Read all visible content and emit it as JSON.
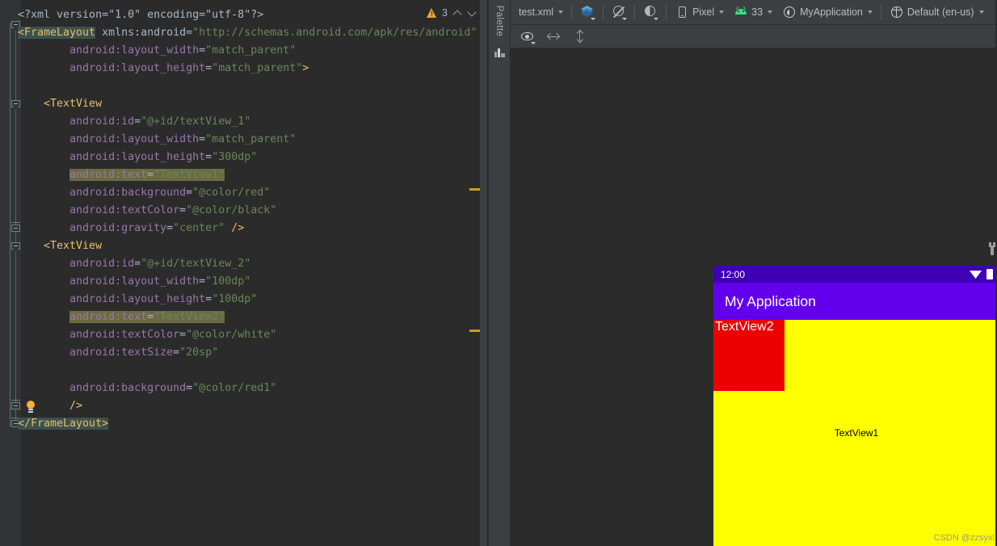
{
  "editor": {
    "code_lines": [
      [
        {
          "t": "<?xml version=\"1.0\" encoding=\"utf-8\"?>",
          "c": "decl"
        }
      ],
      [
        {
          "t": "<FrameLayout",
          "c": "tag hl-tag"
        },
        {
          "t": " xmlns:android",
          "c": "ns"
        },
        {
          "t": "=",
          "c": "eq"
        },
        {
          "t": "\"http://schemas.android.com/apk/res/android\"",
          "c": "val"
        }
      ],
      [
        {
          "t": "        android:layout_width",
          "c": "attr"
        },
        {
          "t": "=",
          "c": "eq"
        },
        {
          "t": "\"match_parent\"",
          "c": "val"
        }
      ],
      [
        {
          "t": "        android:layout_height",
          "c": "attr"
        },
        {
          "t": "=",
          "c": "eq"
        },
        {
          "t": "\"match_parent\"",
          "c": "val"
        },
        {
          "t": ">",
          "c": "tag"
        }
      ],
      [],
      [
        {
          "t": "    <TextView",
          "c": "tag"
        }
      ],
      [
        {
          "t": "        android:id",
          "c": "attr"
        },
        {
          "t": "=",
          "c": "eq"
        },
        {
          "t": "\"@+id/textView_1\"",
          "c": "val"
        }
      ],
      [
        {
          "t": "        android:layout_width",
          "c": "attr"
        },
        {
          "t": "=",
          "c": "eq"
        },
        {
          "t": "\"match_parent\"",
          "c": "val"
        }
      ],
      [
        {
          "t": "        android:layout_height",
          "c": "attr"
        },
        {
          "t": "=",
          "c": "eq"
        },
        {
          "t": "\"300dp\"",
          "c": "val"
        }
      ],
      [
        {
          "t": "        ",
          "c": "attr"
        },
        {
          "t": "android:text",
          "c": "attr hl-attr"
        },
        {
          "t": "=",
          "c": "eq hl-attr"
        },
        {
          "t": "\"TextView1\"",
          "c": "val hl-attr"
        }
      ],
      [
        {
          "t": "        android:background",
          "c": "attr"
        },
        {
          "t": "=",
          "c": "eq"
        },
        {
          "t": "\"@color/red\"",
          "c": "val"
        }
      ],
      [
        {
          "t": "        android:textColor",
          "c": "attr"
        },
        {
          "t": "=",
          "c": "eq"
        },
        {
          "t": "\"@color/black\"",
          "c": "val"
        }
      ],
      [
        {
          "t": "        android:gravity",
          "c": "attr"
        },
        {
          "t": "=",
          "c": "eq"
        },
        {
          "t": "\"center\" ",
          "c": "val"
        },
        {
          "t": "/>",
          "c": "tag"
        }
      ],
      [
        {
          "t": "    <TextView",
          "c": "tag"
        }
      ],
      [
        {
          "t": "        android:id",
          "c": "attr"
        },
        {
          "t": "=",
          "c": "eq"
        },
        {
          "t": "\"@+id/textView_2\"",
          "c": "val"
        }
      ],
      [
        {
          "t": "        android:layout_width",
          "c": "attr"
        },
        {
          "t": "=",
          "c": "eq"
        },
        {
          "t": "\"100dp\"",
          "c": "val"
        }
      ],
      [
        {
          "t": "        android:layout_height",
          "c": "attr"
        },
        {
          "t": "=",
          "c": "eq"
        },
        {
          "t": "\"100dp\"",
          "c": "val"
        }
      ],
      [
        {
          "t": "        ",
          "c": "attr"
        },
        {
          "t": "android:text",
          "c": "attr hl-attr"
        },
        {
          "t": "=",
          "c": "eq hl-attr"
        },
        {
          "t": "\"TextView2\"",
          "c": "val hl-attr"
        }
      ],
      [
        {
          "t": "        android:textColor",
          "c": "attr"
        },
        {
          "t": "=",
          "c": "eq"
        },
        {
          "t": "\"@color/white\"",
          "c": "val"
        }
      ],
      [
        {
          "t": "        android:textSize",
          "c": "attr"
        },
        {
          "t": "=",
          "c": "eq"
        },
        {
          "t": "\"20sp\"",
          "c": "val"
        }
      ],
      [],
      [
        {
          "t": "        android:background",
          "c": "attr"
        },
        {
          "t": "=",
          "c": "eq"
        },
        {
          "t": "\"@color/red1\"",
          "c": "val"
        }
      ],
      [
        {
          "t": "        ",
          "c": "attr"
        },
        {
          "t": "/>",
          "c": "tag"
        }
      ],
      [
        {
          "t": "</FrameLayout>",
          "c": "tag hl-tag"
        }
      ]
    ],
    "inspection": {
      "warning_count": "3",
      "warning_icon": "warning-triangle-icon",
      "prev_icon": "chevron-up-icon",
      "next_icon": "chevron-down-icon"
    },
    "intention_bulb_icon": "lightbulb-icon"
  },
  "palette": {
    "label": "Palette",
    "icon": "palette-bars-icon"
  },
  "design_toolbar": {
    "file_name": "test.xml",
    "layers_icon": "layers-icon",
    "orientation_icon": "screen-rotation-icon",
    "theme_icon": "night-mode-icon",
    "device_icon": "phone-icon",
    "device_name": "Pixel",
    "api_icon": "android-icon",
    "api_level": "33",
    "app_theme_icon": "theme-circle-icon",
    "app_theme": "MyApplication",
    "locale_icon": "globe-icon",
    "locale": "Default (en-us)"
  },
  "design_toolbar2": {
    "eye_icon": "eye-icon",
    "hmargin_icon": "horizontal-resize-icon",
    "vmargin_icon": "vertical-resize-icon"
  },
  "device_preview": {
    "config_icon": "wrench-icon",
    "status_bar": {
      "clock": "12:00",
      "wifi_icon": "wifi-icon",
      "battery_icon": "battery-icon"
    },
    "app_bar_title": "My Application",
    "text_view_1": "TextView1",
    "text_view_2": "TextView2",
    "colors": {
      "status_bar": "#3f00b5",
      "app_bar": "#6200ee",
      "text_view_1_bg": "#ffff00",
      "text_view_2_bg": "#ee0000"
    }
  },
  "watermark": "CSDN @zzsyxl"
}
